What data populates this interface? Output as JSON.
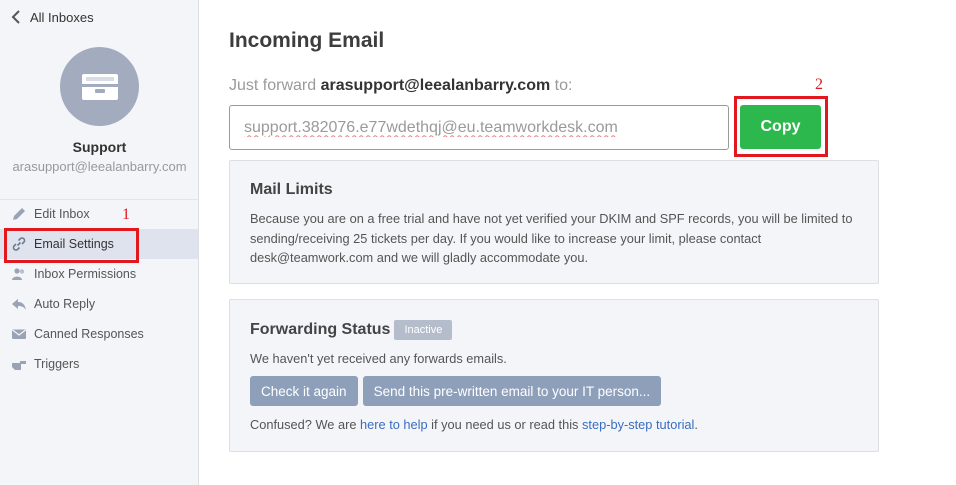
{
  "sidebar": {
    "back_label": "All Inboxes",
    "inbox_name": "Support",
    "inbox_email": "arasupport@leealanbarry.com",
    "items": [
      {
        "label": "Edit Inbox",
        "icon": "pencil-icon"
      },
      {
        "label": "Email Settings",
        "icon": "link-icon",
        "active": true
      },
      {
        "label": "Inbox Permissions",
        "icon": "users-icon"
      },
      {
        "label": "Auto Reply",
        "icon": "reply-icon"
      },
      {
        "label": "Canned Responses",
        "icon": "envelope-icon"
      },
      {
        "label": "Triggers",
        "icon": "pointer-icon"
      }
    ]
  },
  "annotations": {
    "one": "1",
    "two": "2"
  },
  "main": {
    "title": "Incoming Email",
    "forward_prefix": "Just forward ",
    "forward_email": "arasupport@leealanbarry.com",
    "forward_suffix": " to:",
    "forward_address": "support.382076.e77wdethqj@eu.teamworkdesk.com",
    "copy_label": "Copy",
    "mail_limits": {
      "heading": "Mail Limits",
      "text": "Because you are on a free trial and have not yet verified your DKIM and SPF records, you will be limited to sending/receiving 25 tickets per day. If you would like to increase your limit, please contact desk@teamwork.com and we will gladly accommodate you."
    },
    "forwarding": {
      "heading": "Forwarding Status",
      "badge": "Inactive",
      "message": "We haven't yet received any forwards emails.",
      "check_label": "Check it again",
      "send_label": "Send this pre-written email to your IT person...",
      "help_prefix": "Confused? We are ",
      "help_link": "here to help",
      "help_middle": " if you need us or read this ",
      "tutorial_link": "step-by-step tutorial",
      "help_suffix": "."
    }
  },
  "colors": {
    "accent_green": "#2db84d",
    "annotation_red": "#e1191e",
    "link_blue": "#3a6cc0",
    "button_grey": "#8e9fba"
  }
}
